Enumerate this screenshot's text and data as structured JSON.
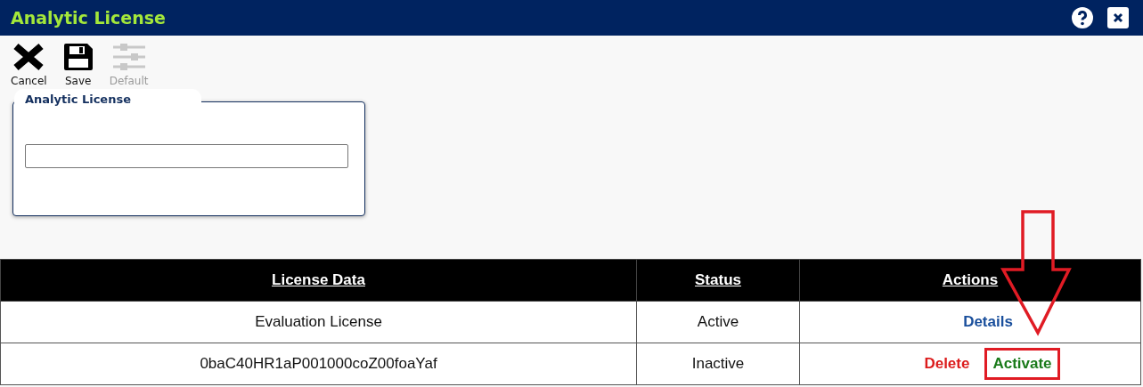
{
  "window": {
    "title": "Analytic License"
  },
  "toolbar": [
    {
      "kind": "cancel",
      "label": "Cancel",
      "disabled": false
    },
    {
      "kind": "save",
      "label": "Save",
      "disabled": false
    },
    {
      "kind": "default",
      "label": "Default",
      "disabled": true
    }
  ],
  "panel": {
    "title": "Analytic License"
  },
  "table": {
    "columns": [
      "License Data",
      "Status",
      "Actions"
    ],
    "rows": [
      {
        "license_data": "Evaluation License",
        "status": "Active",
        "actions": [
          {
            "kind": "details",
            "label": "Details",
            "highlighted": false
          }
        ]
      },
      {
        "license_data": "0baC40HR1aP001000coZ00foaYaf",
        "status": "Inactive",
        "actions": [
          {
            "kind": "delete",
            "label": "Delete",
            "highlighted": false
          },
          {
            "kind": "activate",
            "label": "Activate",
            "highlighted": true
          }
        ]
      }
    ]
  },
  "callout_arrow": true
}
